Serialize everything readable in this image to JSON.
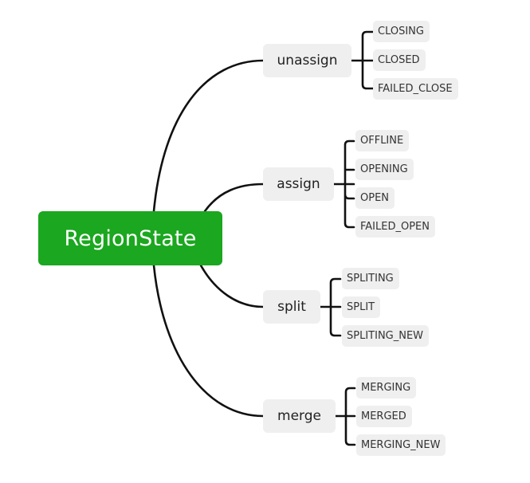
{
  "root": {
    "label": "RegionState",
    "color": "#1ba71f"
  },
  "branches": [
    {
      "label": "unassign",
      "children": [
        "CLOSING",
        "CLOSED",
        "FAILED_CLOSE"
      ]
    },
    {
      "label": "assign",
      "children": [
        "OFFLINE",
        "OPENING",
        "OPEN",
        "FAILED_OPEN"
      ]
    },
    {
      "label": "split",
      "children": [
        "SPLITING",
        "SPLIT",
        "SPLITING_NEW"
      ]
    },
    {
      "label": "merge",
      "children": [
        "MERGING",
        "MERGED",
        "MERGING_NEW"
      ]
    }
  ]
}
